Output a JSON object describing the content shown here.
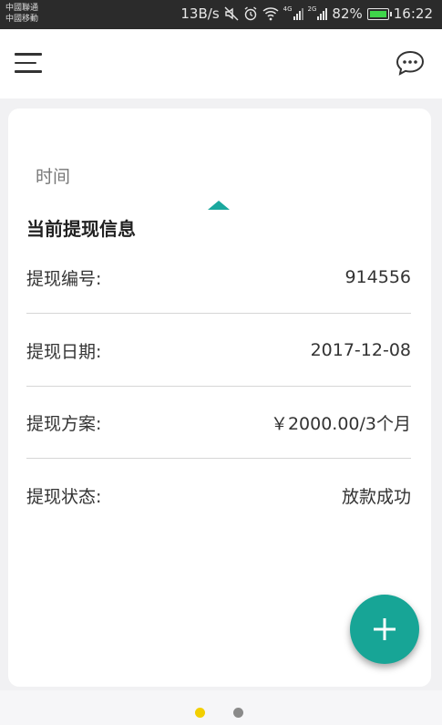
{
  "status_bar": {
    "carrier_1": "中國聯通",
    "carrier_2": "中國移動",
    "network_speed": "13B/s",
    "network_4g": "4G",
    "network_2g": "2G",
    "battery": "82%",
    "time": "16:22",
    "battery_color": "#3fd54a"
  },
  "header": {
    "menu_icon": "hamburger-menu-icon",
    "chat_icon": "chat-bubble-icon"
  },
  "card": {
    "time_label": "时间",
    "section_title": "当前提现信息",
    "rows": [
      {
        "label": "提现编号:",
        "value": "914556"
      },
      {
        "label": "提现日期:",
        "value": "2017-12-08"
      },
      {
        "label": "提现方案:",
        "value": "￥2000.00/3个月"
      },
      {
        "label": "提现状态:",
        "value": "放款成功"
      }
    ]
  },
  "fab": {
    "icon": "plus-icon",
    "color": "#17a596"
  },
  "pager": {
    "active_color": "#f2cf00",
    "inactive_color": "#8a8a8a",
    "count": 2,
    "active_index": 0
  }
}
